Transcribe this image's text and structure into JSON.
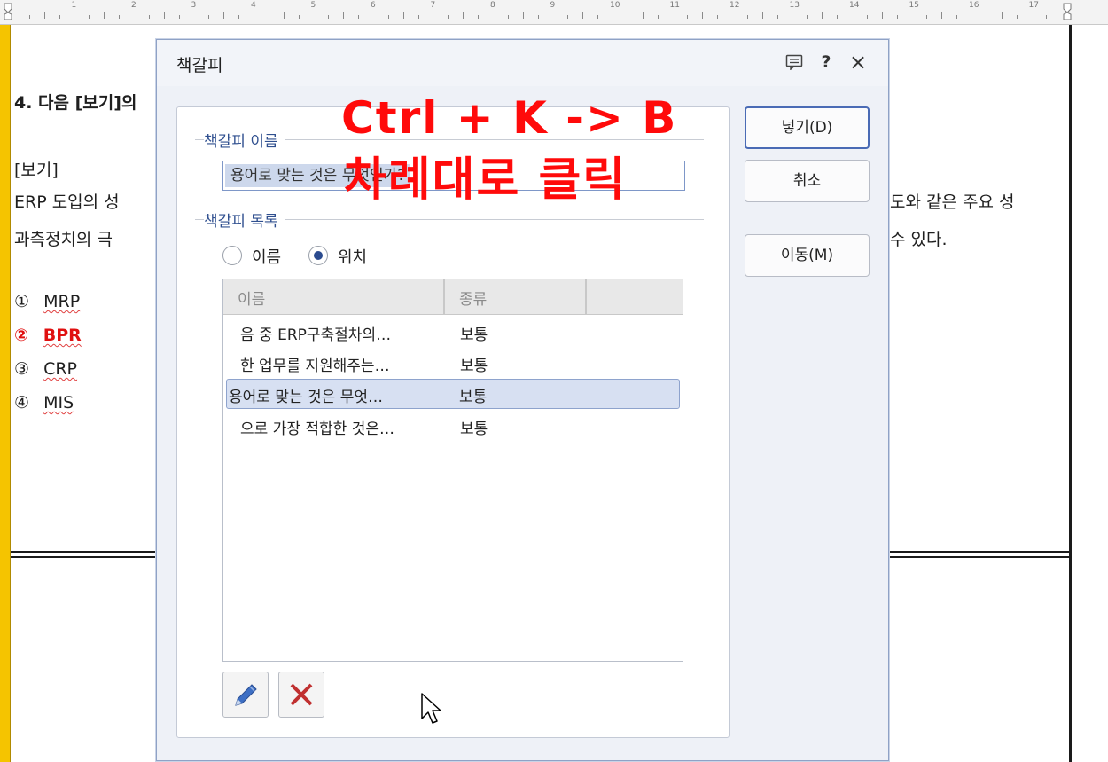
{
  "ruler": {
    "numbers": [
      "1",
      "2",
      "3",
      "4",
      "5",
      "6",
      "7",
      "8",
      "9",
      "10",
      "11",
      "12",
      "13",
      "14",
      "15",
      "16",
      "17"
    ]
  },
  "document": {
    "question": "4. 다음 [보기]의",
    "example_label": "[보기]",
    "line1_left": "ERP 도입의 성",
    "line1_right": "도와 같은 주요 성",
    "line2_left": "과측정치의 극",
    "line2_right": "수 있다.",
    "options": [
      {
        "marker": "①",
        "text": "MRP"
      },
      {
        "marker": "②",
        "text": "BPR"
      },
      {
        "marker": "③",
        "text": "CRP"
      },
      {
        "marker": "④",
        "text": "MIS"
      }
    ]
  },
  "dialog": {
    "title": "책갈피",
    "title_buttons": {
      "help": "?",
      "close": "×"
    },
    "name_group_label": "책갈피 이름",
    "name_value": "용어로 맞는 것은 무엇인가?",
    "list_group_label": "책갈피 목록",
    "sort_options": {
      "by_name": "이름",
      "by_position": "위치",
      "selected": "위치"
    },
    "columns": {
      "name": "이름",
      "type": "종류"
    },
    "rows": [
      {
        "name": "음 중 ERP구축절차의…",
        "type": "보통"
      },
      {
        "name": "한 업무를 지원해주는…",
        "type": "보통"
      },
      {
        "name": "용어로 맞는 것은 무엇…",
        "type": "보통"
      },
      {
        "name": "으로 가장 적합한 것은…",
        "type": "보통"
      }
    ],
    "selected_row": 2,
    "buttons": {
      "insert": "넣기(D)",
      "cancel": "취소",
      "move": "이동(M)"
    }
  },
  "annotation": {
    "line1": "Ctrl + K -> B",
    "line2": "차례대로 클릭",
    "color": "#ff0a0a"
  },
  "colors": {
    "accent": "#2f4f8f",
    "selection": "#d7e0f2",
    "highlight_bar": "#f5c400",
    "delete_icon": "#c03030"
  }
}
